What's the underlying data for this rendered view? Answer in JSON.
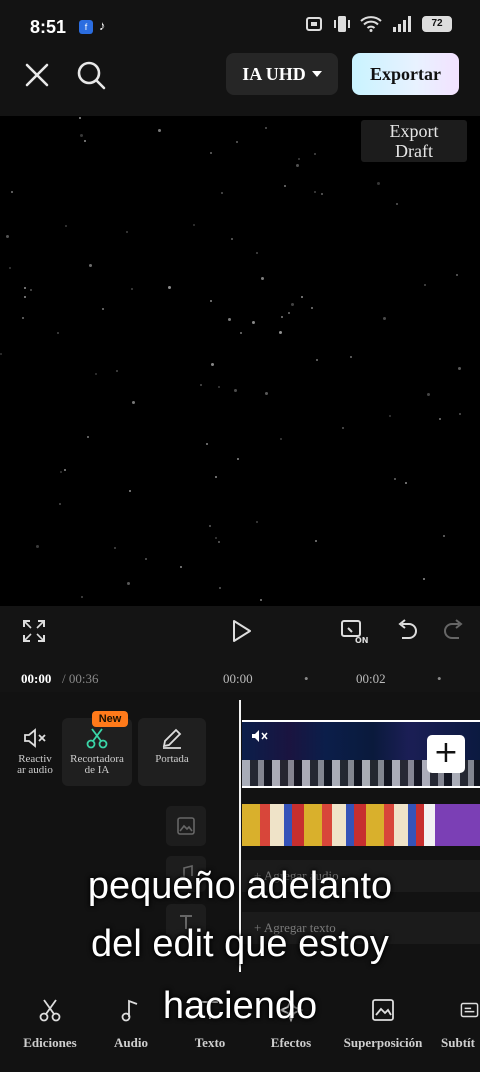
{
  "status_bar": {
    "time": "8:51",
    "battery": "72",
    "app_icons": [
      "facebook-icon",
      "tiktok-icon"
    ]
  },
  "header": {
    "quality_label": "IA UHD",
    "export_label": "Exportar"
  },
  "preview": {
    "draft_badge_line1": "Export",
    "draft_badge_line2": "Draft"
  },
  "timeline": {
    "current_time": "00:00",
    "total_time": "/ 00:36",
    "marker_1": "00:00",
    "marker_2": "00:02",
    "tools": [
      {
        "label_line1": "Reactiv",
        "label_line2": "ar audio"
      },
      {
        "label_line1": "Recortadora",
        "label_line2": "de IA"
      },
      {
        "label_line1": "Portada",
        "label_line2": ""
      }
    ],
    "new_badge": "New",
    "add_audio_label": "+ Agregar audio",
    "add_text_label": "+ Agregar texto"
  },
  "caption": {
    "line1": "pequeño adelanto",
    "line2": "del edit que estoy",
    "line3": "haciendo"
  },
  "bottom_nav": [
    {
      "label": "Ediciones",
      "icon": "scissors-icon"
    },
    {
      "label": "Audio",
      "icon": "music-note-icon"
    },
    {
      "label": "Texto",
      "icon": "text-icon"
    },
    {
      "label": "Efectos",
      "icon": "sparkle-icon"
    },
    {
      "label": "Superposición",
      "icon": "overlay-icon"
    },
    {
      "label": "Subtít",
      "icon": "subtitles-icon"
    }
  ],
  "colors": {
    "accent_export": "#d6f2ff",
    "new_badge": "#ff7a1a",
    "background": "#111111"
  }
}
